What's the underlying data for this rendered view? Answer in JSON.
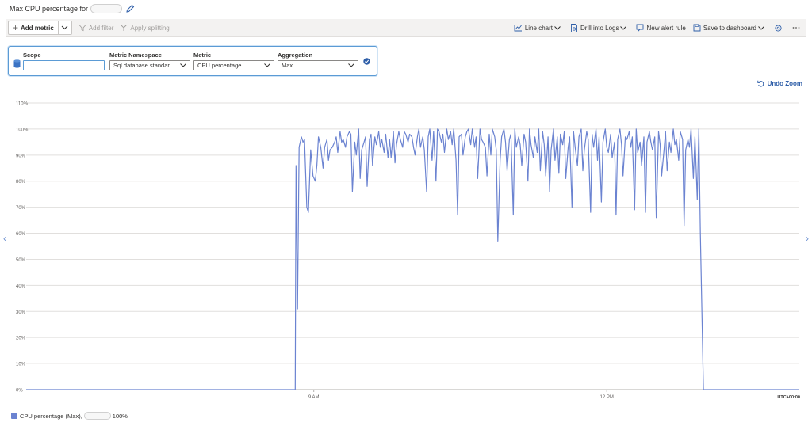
{
  "header": {
    "title": "Max CPU percentage for"
  },
  "toolbar": {
    "add_metric": "Add metric",
    "add_filter": "Add filter",
    "apply_splitting": "Apply splitting",
    "line_chart": "Line chart",
    "drill_logs": "Drill into Logs",
    "new_alert": "New alert rule",
    "save_dashboard": "Save to dashboard"
  },
  "metric_row": {
    "scope_label": "Scope",
    "scope_value": "",
    "namespace_label": "Metric Namespace",
    "namespace_value": "Sql database standar...",
    "metric_label": "Metric",
    "metric_value": "CPU percentage",
    "aggregation_label": "Aggregation",
    "aggregation_value": "Max"
  },
  "undo_zoom": "Undo Zoom",
  "chart_data": {
    "type": "line",
    "y_ticks": [
      "0%",
      "10%",
      "20%",
      "30%",
      "40%",
      "50%",
      "60%",
      "70%",
      "80%",
      "90%",
      "100%",
      "110%"
    ],
    "x_ticks": [
      {
        "label": "9 AM",
        "t": 0.372
      },
      {
        "label": "12 PM",
        "t": 0.751
      }
    ],
    "timezone": "UTC+00:00",
    "ylim": [
      0,
      110
    ],
    "grid": true,
    "legend_position": "bottom-left",
    "series": [
      {
        "name": "CPU percentage (Max),",
        "summary_value": "100%",
        "color": "#6b83d1",
        "points": [
          [
            0,
            0
          ],
          [
            0.348,
            0
          ],
          [
            0.349,
            86
          ],
          [
            0.351,
            31
          ],
          [
            0.353,
            93
          ],
          [
            0.356,
            97
          ],
          [
            0.358,
            95
          ],
          [
            0.36,
            96
          ],
          [
            0.363,
            70
          ],
          [
            0.365,
            68
          ],
          [
            0.368,
            92
          ],
          [
            0.371,
            82
          ],
          [
            0.374,
            80
          ],
          [
            0.376,
            86
          ],
          [
            0.378,
            97
          ],
          [
            0.381,
            93
          ],
          [
            0.384,
            85
          ],
          [
            0.386,
            93
          ],
          [
            0.389,
            96
          ],
          [
            0.391,
            88
          ],
          [
            0.393,
            92
          ],
          [
            0.396,
            93
          ],
          [
            0.399,
            95
          ],
          [
            0.401,
            97
          ],
          [
            0.403,
            91
          ],
          [
            0.406,
            99
          ],
          [
            0.408,
            95
          ],
          [
            0.41,
            96
          ],
          [
            0.413,
            93
          ],
          [
            0.415,
            97
          ],
          [
            0.418,
            99
          ],
          [
            0.42,
            98
          ],
          [
            0.422,
            76
          ],
          [
            0.425,
            95
          ],
          [
            0.427,
            90
          ],
          [
            0.43,
            100
          ],
          [
            0.432,
            81
          ],
          [
            0.434,
            92
          ],
          [
            0.437,
            95
          ],
          [
            0.439,
            97
          ],
          [
            0.441,
            78
          ],
          [
            0.444,
            96
          ],
          [
            0.446,
            98
          ],
          [
            0.448,
            86
          ],
          [
            0.451,
            97
          ],
          [
            0.453,
            94
          ],
          [
            0.456,
            99
          ],
          [
            0.458,
            93
          ],
          [
            0.46,
            96
          ],
          [
            0.463,
            91
          ],
          [
            0.465,
            98
          ],
          [
            0.468,
            89
          ],
          [
            0.47,
            96
          ],
          [
            0.472,
            89
          ],
          [
            0.475,
            99
          ],
          [
            0.477,
            87
          ],
          [
            0.479,
            94
          ],
          [
            0.482,
            99
          ],
          [
            0.484,
            96
          ],
          [
            0.487,
            93
          ],
          [
            0.489,
            99
          ],
          [
            0.491,
            98
          ],
          [
            0.494,
            95
          ],
          [
            0.496,
            98
          ],
          [
            0.499,
            97
          ],
          [
            0.501,
            93
          ],
          [
            0.503,
            90
          ],
          [
            0.506,
            97
          ],
          [
            0.508,
            100
          ],
          [
            0.51,
            93
          ],
          [
            0.513,
            97
          ],
          [
            0.515,
            92
          ],
          [
            0.518,
            76
          ],
          [
            0.52,
            97
          ],
          [
            0.522,
            100
          ],
          [
            0.525,
            88
          ],
          [
            0.527,
            99
          ],
          [
            0.53,
            80
          ],
          [
            0.532,
            100
          ],
          [
            0.534,
            99
          ],
          [
            0.537,
            95
          ],
          [
            0.539,
            98
          ],
          [
            0.541,
            91
          ],
          [
            0.544,
            100
          ],
          [
            0.546,
            96
          ],
          [
            0.549,
            99
          ],
          [
            0.551,
            94
          ],
          [
            0.553,
            100
          ],
          [
            0.556,
            88
          ],
          [
            0.558,
            67
          ],
          [
            0.56,
            97
          ],
          [
            0.563,
            98
          ],
          [
            0.565,
            90
          ],
          [
            0.568,
            97
          ],
          [
            0.57,
            99
          ],
          [
            0.572,
            100
          ],
          [
            0.575,
            94
          ],
          [
            0.577,
            100
          ],
          [
            0.58,
            93
          ],
          [
            0.582,
            97
          ],
          [
            0.584,
            81
          ],
          [
            0.587,
            100
          ],
          [
            0.589,
            96
          ],
          [
            0.591,
            95
          ],
          [
            0.594,
            93
          ],
          [
            0.596,
            82
          ],
          [
            0.599,
            98
          ],
          [
            0.601,
            90
          ],
          [
            0.603,
            100
          ],
          [
            0.606,
            97
          ],
          [
            0.608,
            92
          ],
          [
            0.61,
            57
          ],
          [
            0.613,
            88
          ],
          [
            0.615,
            97
          ],
          [
            0.618,
            100
          ],
          [
            0.62,
            95
          ],
          [
            0.622,
            84
          ],
          [
            0.625,
            96
          ],
          [
            0.627,
            98
          ],
          [
            0.63,
            67
          ],
          [
            0.632,
            100
          ],
          [
            0.634,
            93
          ],
          [
            0.637,
            97
          ],
          [
            0.639,
            94
          ],
          [
            0.641,
            86
          ],
          [
            0.644,
            98
          ],
          [
            0.646,
            95
          ],
          [
            0.649,
            80
          ],
          [
            0.651,
            100
          ],
          [
            0.653,
            94
          ],
          [
            0.656,
            89
          ],
          [
            0.658,
            97
          ],
          [
            0.661,
            91
          ],
          [
            0.663,
            100
          ],
          [
            0.665,
            84
          ],
          [
            0.668,
            99
          ],
          [
            0.67,
            94
          ],
          [
            0.672,
            82
          ],
          [
            0.675,
            97
          ],
          [
            0.677,
            76
          ],
          [
            0.679,
            92
          ],
          [
            0.682,
            100
          ],
          [
            0.684,
            88
          ],
          [
            0.687,
            97
          ],
          [
            0.689,
            83
          ],
          [
            0.691,
            98
          ],
          [
            0.694,
            94
          ],
          [
            0.696,
            99
          ],
          [
            0.698,
            81
          ],
          [
            0.701,
            93
          ],
          [
            0.703,
            97
          ],
          [
            0.706,
            70
          ],
          [
            0.708,
            99
          ],
          [
            0.71,
            93
          ],
          [
            0.713,
            86
          ],
          [
            0.715,
            97
          ],
          [
            0.718,
            100
          ],
          [
            0.72,
            84
          ],
          [
            0.722,
            92
          ],
          [
            0.725,
            99
          ],
          [
            0.727,
            96
          ],
          [
            0.73,
            68
          ],
          [
            0.732,
            98
          ],
          [
            0.734,
            93
          ],
          [
            0.737,
            100
          ],
          [
            0.739,
            88
          ],
          [
            0.741,
            97
          ],
          [
            0.744,
            72
          ],
          [
            0.746,
            95
          ],
          [
            0.749,
            100
          ],
          [
            0.751,
            93
          ],
          [
            0.753,
            91
          ],
          [
            0.756,
            98
          ],
          [
            0.758,
            89
          ],
          [
            0.761,
            95
          ],
          [
            0.763,
            67
          ],
          [
            0.765,
            96
          ],
          [
            0.768,
            100
          ],
          [
            0.77,
            94
          ],
          [
            0.772,
            82
          ],
          [
            0.775,
            97
          ],
          [
            0.777,
            96
          ],
          [
            0.78,
            99
          ],
          [
            0.782,
            93
          ],
          [
            0.784,
            97
          ],
          [
            0.787,
            69
          ],
          [
            0.789,
            100
          ],
          [
            0.791,
            91
          ],
          [
            0.794,
            95
          ],
          [
            0.796,
            86
          ],
          [
            0.799,
            97
          ],
          [
            0.801,
            68
          ],
          [
            0.803,
            95
          ],
          [
            0.806,
            99
          ],
          [
            0.808,
            95
          ],
          [
            0.81,
            92
          ],
          [
            0.813,
            97
          ],
          [
            0.815,
            66
          ],
          [
            0.818,
            99
          ],
          [
            0.82,
            94
          ],
          [
            0.822,
            82
          ],
          [
            0.825,
            92
          ],
          [
            0.827,
            99
          ],
          [
            0.829,
            84
          ],
          [
            0.832,
            95
          ],
          [
            0.834,
            91
          ],
          [
            0.837,
            100
          ],
          [
            0.839,
            94
          ],
          [
            0.841,
            96
          ],
          [
            0.844,
            88
          ],
          [
            0.846,
            99
          ],
          [
            0.849,
            96
          ],
          [
            0.851,
            63
          ],
          [
            0.853,
            92
          ],
          [
            0.856,
            96
          ],
          [
            0.858,
            93
          ],
          [
            0.86,
            100
          ],
          [
            0.863,
            81
          ],
          [
            0.865,
            97
          ],
          [
            0.868,
            73
          ],
          [
            0.87,
            100
          ],
          [
            0.872,
            60
          ],
          [
            0.876,
            0
          ],
          [
            1,
            0
          ]
        ]
      }
    ]
  }
}
